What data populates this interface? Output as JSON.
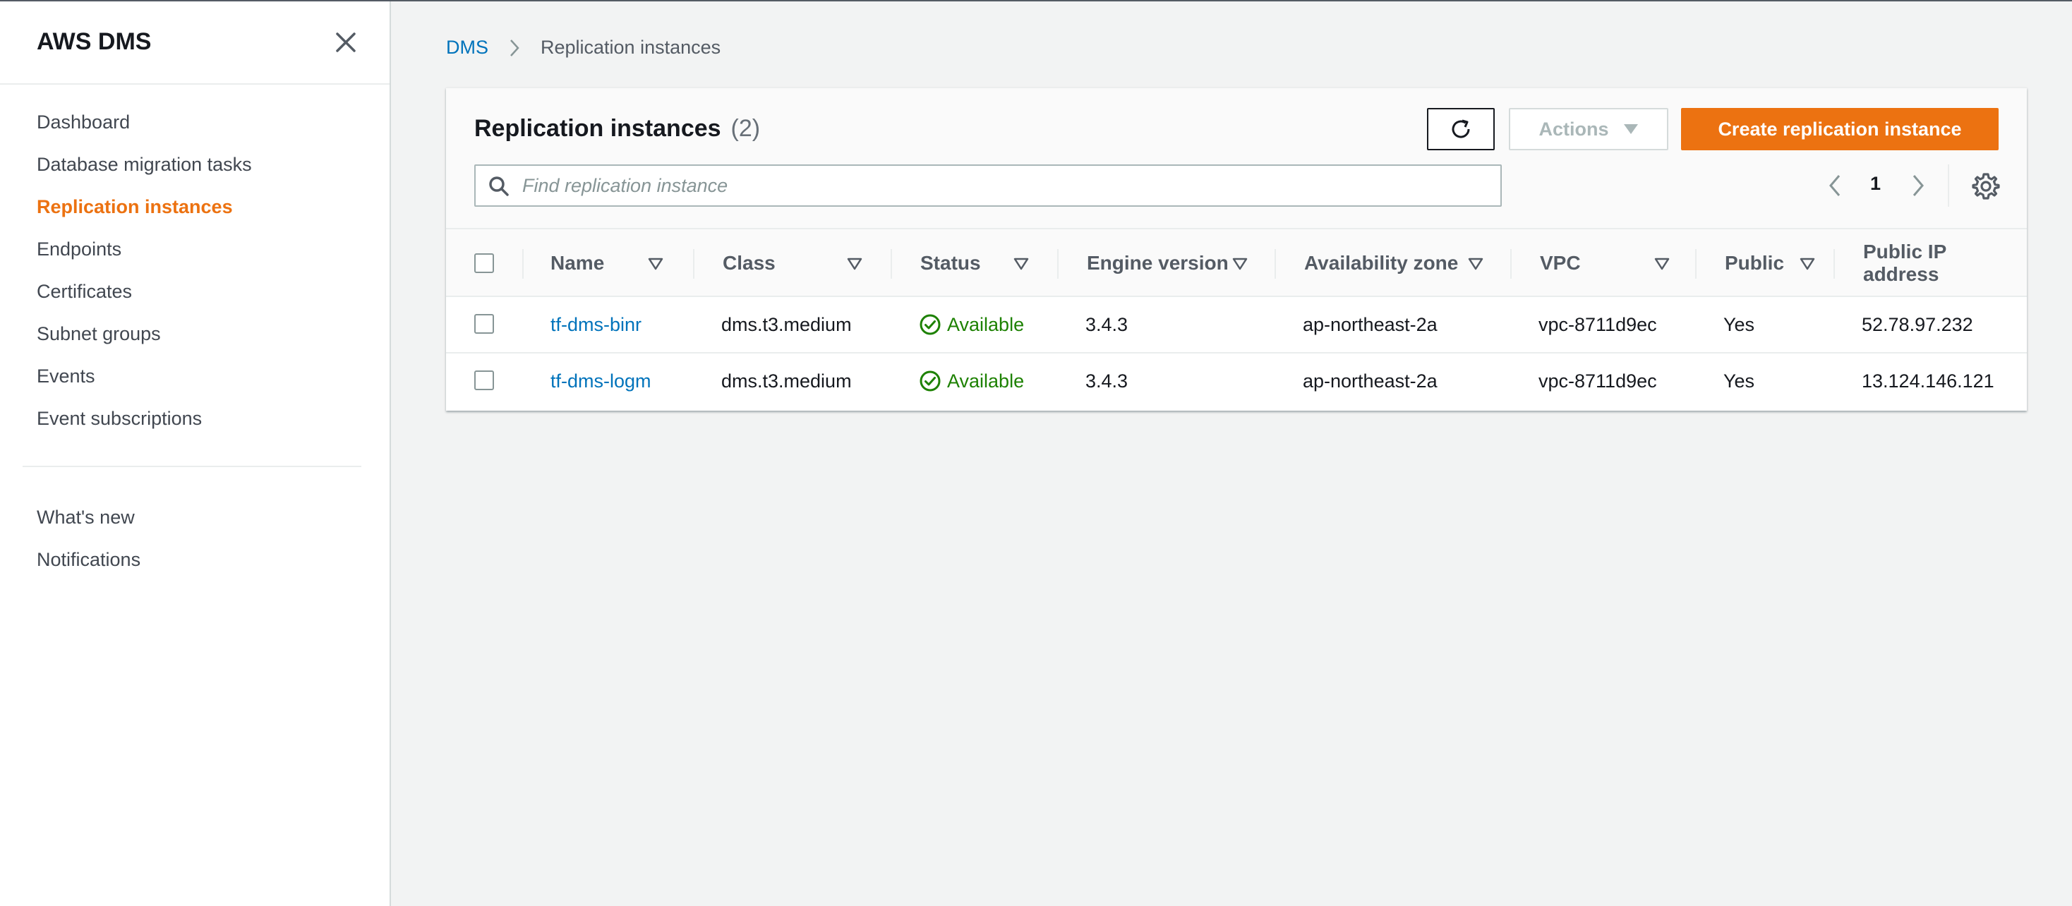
{
  "sidebar": {
    "title": "AWS DMS",
    "nav": [
      {
        "label": "Dashboard"
      },
      {
        "label": "Database migration tasks"
      },
      {
        "label": "Replication instances",
        "active": true
      },
      {
        "label": "Endpoints"
      },
      {
        "label": "Certificates"
      },
      {
        "label": "Subnet groups"
      },
      {
        "label": "Events"
      },
      {
        "label": "Event subscriptions"
      }
    ],
    "secondary": [
      {
        "label": "What's new"
      },
      {
        "label": "Notifications"
      }
    ]
  },
  "breadcrumb": {
    "root": "DMS",
    "current": "Replication instances"
  },
  "panel": {
    "title": "Replication instances",
    "count": "(2)",
    "actions_label": "Actions",
    "create_label": "Create replication instance",
    "search_placeholder": "Find replication instance",
    "page": "1"
  },
  "table": {
    "columns": [
      "Name",
      "Class",
      "Status",
      "Engine version",
      "Availability zone",
      "VPC",
      "Public",
      "Public IP address"
    ],
    "rows": [
      {
        "name": "tf-dms-binr",
        "class": "dms.t3.medium",
        "status": "Available",
        "engine": "3.4.3",
        "az": "ap-northeast-2a",
        "vpc": "vpc-8711d9ec",
        "public": "Yes",
        "ip": "52.78.97.232"
      },
      {
        "name": "tf-dms-logm",
        "class": "dms.t3.medium",
        "status": "Available",
        "engine": "3.4.3",
        "az": "ap-northeast-2a",
        "vpc": "vpc-8711d9ec",
        "public": "Yes",
        "ip": "13.124.146.121"
      }
    ]
  },
  "colors": {
    "accent": "#ec7211",
    "link": "#0073bb",
    "success": "#1d8102"
  },
  "icons": [
    "close-icon",
    "chevron-right-icon",
    "refresh-icon",
    "caret-down-icon",
    "search-icon",
    "chevron-left-icon",
    "gear-icon",
    "sort-icon",
    "check-circle-icon"
  ]
}
